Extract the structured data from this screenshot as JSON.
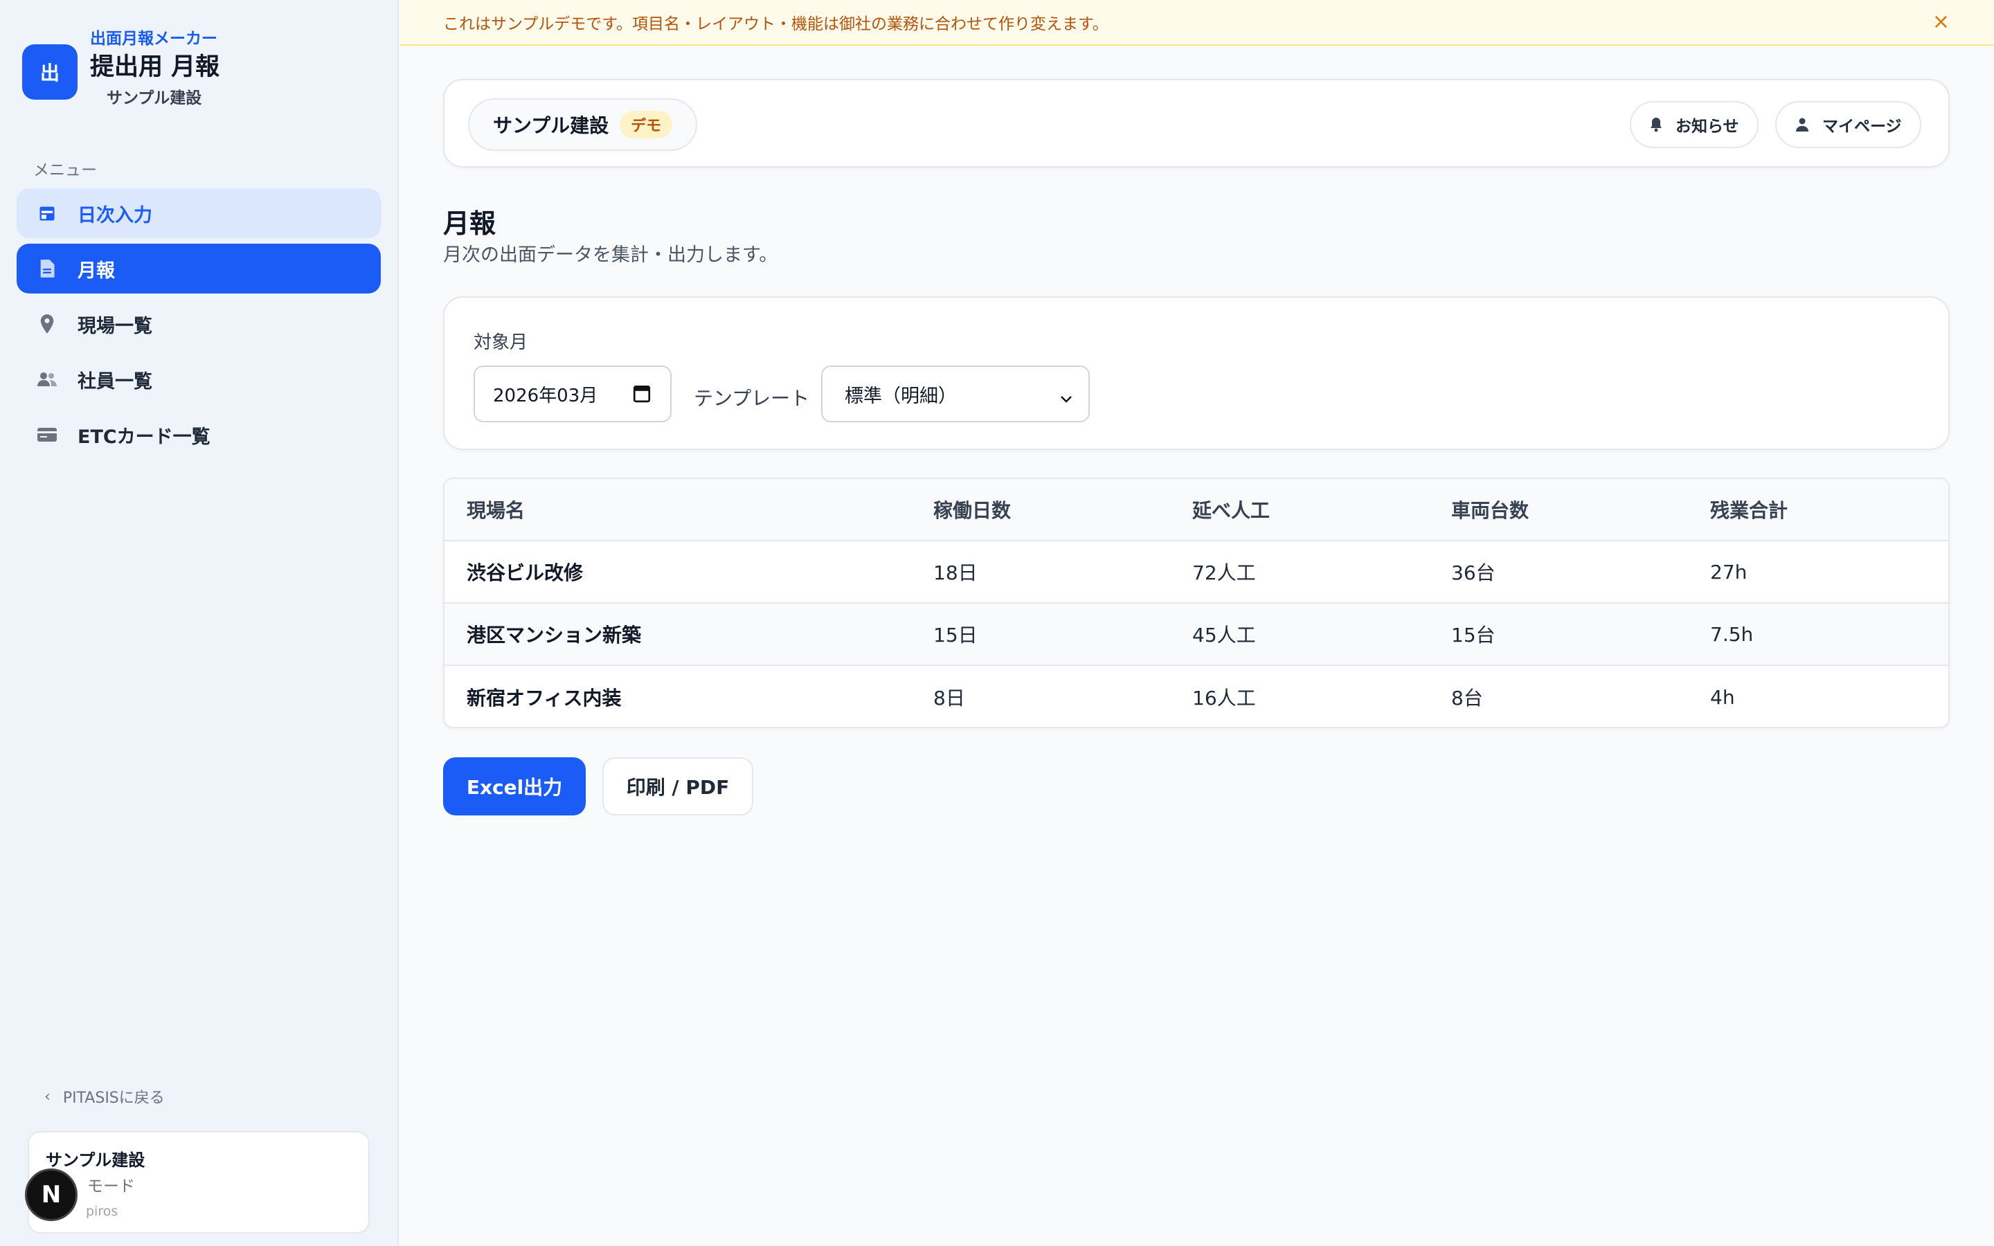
{
  "brand": {
    "logo_text": "出",
    "subtitle": "出面月報メーカー",
    "title": "提出用 月報",
    "company": "サンプル建設"
  },
  "sidebar": {
    "menu_label": "メニュー",
    "items": [
      {
        "label": "日次入力",
        "icon": "calendar-icon",
        "state": "hover"
      },
      {
        "label": "月報",
        "icon": "document-icon",
        "state": "active"
      },
      {
        "label": "現場一覧",
        "icon": "location-pin-icon",
        "state": "normal"
      },
      {
        "label": "社員一覧",
        "icon": "people-icon",
        "state": "normal"
      },
      {
        "label": "ETCカード一覧",
        "icon": "card-icon",
        "state": "normal"
      }
    ],
    "back_label": "PITASISに戻る",
    "account": {
      "company": "サンプル建設",
      "mode": "モード",
      "user": "piros"
    },
    "n_badge": "N"
  },
  "banner": {
    "text": "これはサンプルデモです。項目名・レイアウト・機能は御社の業務に合わせて作り変えます。",
    "close": "×"
  },
  "header": {
    "company": "サンプル建設",
    "badge": "デモ",
    "notice_label": "お知らせ",
    "mypage_label": "マイページ"
  },
  "page": {
    "title": "月報",
    "description": "月次の出面データを集計・出力します。"
  },
  "filters": {
    "month_label": "対象月",
    "month_value": "2026年03月",
    "template_label": "テンプレート",
    "template_value": "標準（明細）"
  },
  "table": {
    "columns": [
      "現場名",
      "稼働日数",
      "延べ人工",
      "車両台数",
      "残業合計"
    ],
    "rows": [
      [
        "渋谷ビル改修",
        "18日",
        "72人工",
        "36台",
        "27h"
      ],
      [
        "港区マンション新築",
        "15日",
        "45人工",
        "15台",
        "7.5h"
      ],
      [
        "新宿オフィス内装",
        "8日",
        "16人工",
        "8台",
        "4h"
      ]
    ]
  },
  "actions": {
    "excel_label": "Excel出力",
    "print_label": "印刷 / PDF"
  },
  "colors": {
    "primary": "#1a5cf5",
    "banner_bg": "#fffbeb",
    "banner_text": "#b45309"
  }
}
